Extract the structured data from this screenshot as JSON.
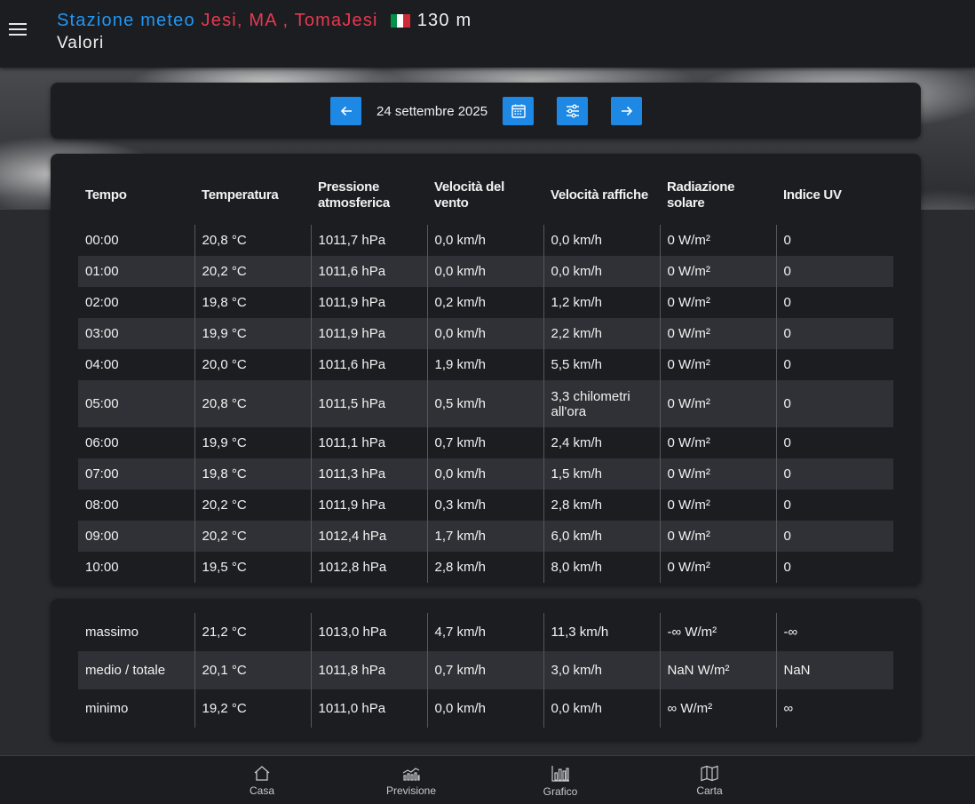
{
  "header": {
    "title_prefix": "Stazione meteo",
    "title_location": "Jesi, MA , TomaJesi",
    "altitude": "130 m",
    "subtitle": "Valori",
    "flag_colors": [
      "#009246",
      "#ffffff",
      "#ce2b37"
    ]
  },
  "datebar": {
    "date": "24 settembre 2025",
    "icons": [
      "arrow-left-icon",
      "calendar-icon",
      "filter-icon",
      "arrow-right-icon"
    ]
  },
  "table": {
    "headers": [
      "Tempo",
      "Temperatura",
      "Pressione atmosferica",
      "Velocità del vento",
      "Velocità raffiche",
      "Radiazione solare",
      "Indice UV"
    ],
    "rows": [
      [
        "00:00",
        "20,8 °C",
        "1011,7 hPa",
        "0,0 km/h",
        "0,0 km/h",
        "0 W/m²",
        "0"
      ],
      [
        "01:00",
        "20,2 °C",
        "1011,6 hPa",
        "0,0 km/h",
        "0,0 km/h",
        "0 W/m²",
        "0"
      ],
      [
        "02:00",
        "19,8 °C",
        "1011,9 hPa",
        "0,2 km/h",
        "1,2 km/h",
        "0 W/m²",
        "0"
      ],
      [
        "03:00",
        "19,9 °C",
        "1011,9 hPa",
        "0,0 km/h",
        "2,2 km/h",
        "0 W/m²",
        "0"
      ],
      [
        "04:00",
        "20,0 °C",
        "1011,6 hPa",
        "1,9 km/h",
        "5,5 km/h",
        "0 W/m²",
        "0"
      ],
      [
        "05:00",
        "20,8 °C",
        "1011,5 hPa",
        "0,5 km/h",
        "3,3 chilometri all'ora",
        "0 W/m²",
        "0"
      ],
      [
        "06:00",
        "19,9 °C",
        "1011,1 hPa",
        "0,7 km/h",
        "2,4 km/h",
        "0 W/m²",
        "0"
      ],
      [
        "07:00",
        "19,8 °C",
        "1011,3 hPa",
        "0,0 km/h",
        "1,5 km/h",
        "0 W/m²",
        "0"
      ],
      [
        "08:00",
        "20,2 °C",
        "1011,9 hPa",
        "0,3 km/h",
        "2,8 km/h",
        "0 W/m²",
        "0"
      ],
      [
        "09:00",
        "20,2 °C",
        "1012,4 hPa",
        "1,7 km/h",
        "6,0 km/h",
        "0 W/m²",
        "0"
      ],
      [
        "10:00",
        "19,5 °C",
        "1012,8 hPa",
        "2,8 km/h",
        "8,0 km/h",
        "0 W/m²",
        "0"
      ]
    ]
  },
  "summary": {
    "rows": [
      [
        "massimo",
        "21,2 °C",
        "1013,0 hPa",
        "4,7 km/h",
        "11,3 km/h",
        "-∞ W/m²",
        "-∞"
      ],
      [
        "medio / totale",
        "20,1 °C",
        "1011,8 hPa",
        "0,7 km/h",
        "3,0 km/h",
        "NaN W/m²",
        "NaN"
      ],
      [
        "minimo",
        "19,2 °C",
        "1011,0 hPa",
        "0,0 km/h",
        "0,0 km/h",
        "∞ W/m²",
        "∞"
      ]
    ]
  },
  "bottom_nav": {
    "items": [
      {
        "label": "Casa",
        "icon": "home-icon"
      },
      {
        "label": "Previsione",
        "icon": "forecast-icon"
      },
      {
        "label": "Grafico",
        "icon": "chart-icon"
      },
      {
        "label": "Carta",
        "icon": "map-icon"
      }
    ]
  },
  "colors": {
    "accent": "#1e88e5",
    "title_blue": "#2196f3",
    "title_red": "#e8384f",
    "surface": "#1c1d21",
    "row_alt": "#303136"
  }
}
